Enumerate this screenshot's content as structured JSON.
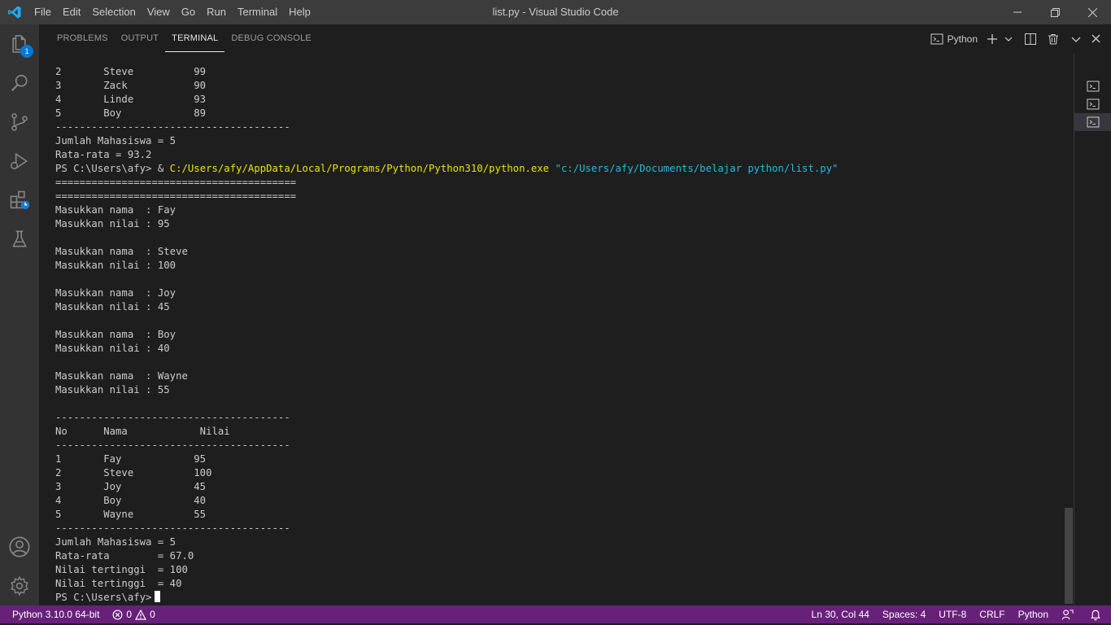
{
  "window": {
    "title": "list.py - Visual Studio Code",
    "menu": [
      "File",
      "Edit",
      "Selection",
      "View",
      "Go",
      "Run",
      "Terminal",
      "Help"
    ]
  },
  "activitybar": {
    "items": [
      {
        "name": "explorer-icon",
        "badge": "1"
      },
      {
        "name": "search-icon"
      },
      {
        "name": "source-control-icon"
      },
      {
        "name": "run-debug-icon"
      },
      {
        "name": "extensions-icon"
      },
      {
        "name": "testing-icon"
      }
    ],
    "bottom": [
      {
        "name": "accounts-icon"
      },
      {
        "name": "settings-gear-icon"
      }
    ]
  },
  "panel": {
    "tabs": [
      "PROBLEMS",
      "OUTPUT",
      "TERMINAL",
      "DEBUG CONSOLE"
    ],
    "active_tab": "TERMINAL",
    "terminal_selector": "Python"
  },
  "terminal": {
    "lines": [
      {
        "text": "2       Steve          99"
      },
      {
        "text": "3       Zack           90"
      },
      {
        "text": "4       Linde          93"
      },
      {
        "text": "5       Boy            89"
      },
      {
        "text": "---------------------------------------"
      },
      {
        "text": "Jumlah Mahasiswa = 5"
      },
      {
        "text": "Rata-rata = 93.2"
      },
      {
        "prompt": "PS C:\\Users\\afy> & ",
        "exe": "C:/Users/afy/AppData/Local/Programs/Python/Python310/python.exe",
        "arg": " \"c:/Users/afy/Documents/belajar python/list.py\""
      },
      {
        "text": "========================================"
      },
      {
        "text": "========================================"
      },
      {
        "text": "Masukkan nama  : Fay"
      },
      {
        "text": "Masukkan nilai : 95"
      },
      {
        "text": ""
      },
      {
        "text": "Masukkan nama  : Steve"
      },
      {
        "text": "Masukkan nilai : 100"
      },
      {
        "text": ""
      },
      {
        "text": "Masukkan nama  : Joy"
      },
      {
        "text": "Masukkan nilai : 45"
      },
      {
        "text": ""
      },
      {
        "text": "Masukkan nama  : Boy"
      },
      {
        "text": "Masukkan nilai : 40"
      },
      {
        "text": ""
      },
      {
        "text": "Masukkan nama  : Wayne"
      },
      {
        "text": "Masukkan nilai : 55"
      },
      {
        "text": ""
      },
      {
        "text": "---------------------------------------"
      },
      {
        "text": "No      Nama            Nilai"
      },
      {
        "text": "---------------------------------------"
      },
      {
        "text": "1       Fay            95"
      },
      {
        "text": "2       Steve          100"
      },
      {
        "text": "3       Joy            45"
      },
      {
        "text": "4       Boy            40"
      },
      {
        "text": "5       Wayne          55"
      },
      {
        "text": "---------------------------------------"
      },
      {
        "text": "Jumlah Mahasiswa = 5"
      },
      {
        "text": "Rata-rata        = 67.0"
      },
      {
        "text": "Nilai tertinggi  = 100"
      },
      {
        "text": "Nilai tertinggi  = 40"
      }
    ],
    "prompt": "PS C:\\Users\\afy>"
  },
  "statusbar": {
    "interpreter": "Python 3.10.0 64-bit",
    "errors": "0",
    "warnings": "0",
    "position": "Ln 30, Col 44",
    "spaces": "Spaces: 4",
    "encoding": "UTF-8",
    "eol": "CRLF",
    "language": "Python"
  },
  "colors": {
    "statusbar": "#68217a",
    "titlebar": "#3c3c3c",
    "activitybar": "#333333",
    "editor_bg": "#1e1e1e"
  }
}
